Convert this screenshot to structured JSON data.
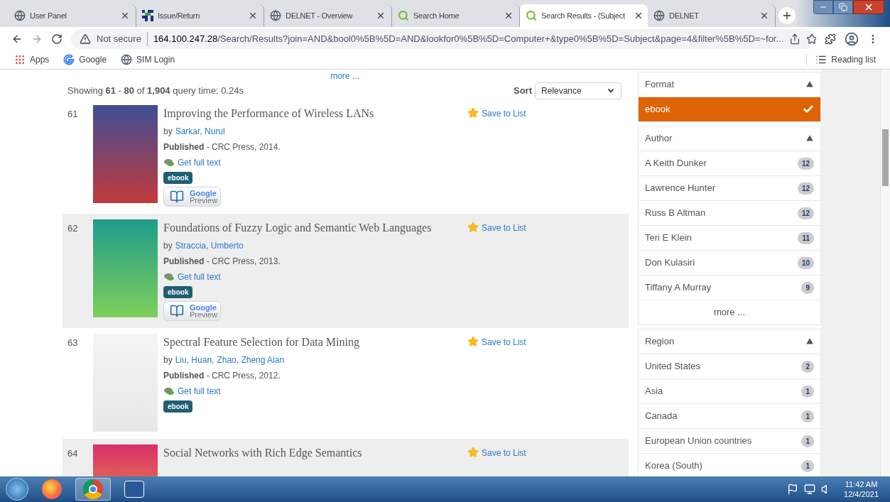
{
  "tabs": [
    {
      "title": "User Panel",
      "kind": "globe",
      "selected": false
    },
    {
      "title": "Issue/Return",
      "kind": "grid",
      "selected": false
    },
    {
      "title": "DELNET - Overview",
      "kind": "globe",
      "selected": false
    },
    {
      "title": "Search Home",
      "kind": "search",
      "selected": false
    },
    {
      "title": "Search Results - (Subject",
      "kind": "search",
      "selected": true
    },
    {
      "title": "DELNET",
      "kind": "globe",
      "selected": false
    }
  ],
  "address_bar": {
    "security": "Not secure",
    "host": "164.100.247.28",
    "path": "/Search/Results?join=AND&bool0%5B%5D=AND&lookfor0%5B%5D=Computer+&type0%5B%5D=Subject&page=4&filter%5B%5D=~for..."
  },
  "bookmarks": [
    {
      "label": "Apps",
      "kind": "apps"
    },
    {
      "label": "Google",
      "kind": "google"
    },
    {
      "label": "SIM Login",
      "kind": "globe"
    }
  ],
  "reading_list": "Reading list",
  "top_more": "more ...",
  "summary": "Showing **61** - **80** of **1,904** query time: 0.24s",
  "sort": {
    "label": "Sort",
    "value": "Relevance"
  },
  "results": [
    {
      "number": "61",
      "title": "Improving the Performance of Wireless LANs",
      "by_label": "by",
      "authors": [
        "Sarkar, Nurul"
      ],
      "published_label": "Published",
      "published": " - CRC Press, 2014.",
      "full_text": "Get full text",
      "format": "ebook",
      "preview": [
        "Google",
        "Preview"
      ],
      "save": "Save to List"
    },
    {
      "number": "62",
      "title": "Foundations of Fuzzy Logic and Semantic Web Languages",
      "by_label": "by",
      "authors": [
        "Straccia, Umberto"
      ],
      "published_label": "Published",
      "published": " - CRC Press, 2013.",
      "full_text": "Get full text",
      "format": "ebook",
      "preview": [
        "Google",
        "Preview"
      ],
      "save": "Save to List"
    },
    {
      "number": "63",
      "title": "Spectral Feature Selection for Data Mining",
      "by_label": "by",
      "authors": [
        "Liu, Huan,",
        "Zhao, Zheng Alan"
      ],
      "published_label": "Published",
      "published": " - CRC Press, 2012.",
      "full_text": "Get full text",
      "format": "ebook",
      "save": "Save to List"
    },
    {
      "number": "64",
      "title": "Social Networks with Rich Edge Semantics",
      "save": "Save to List"
    }
  ],
  "facets": [
    {
      "title": "Format",
      "expanded": true,
      "items": [
        {
          "label": "ebook",
          "selected": true
        }
      ]
    },
    {
      "title": "Author",
      "expanded": true,
      "items": [
        {
          "label": "A Keith Dunker",
          "count": "12",
          "selected": false
        },
        {
          "label": "Lawrence Hunter",
          "count": "12",
          "selected": false
        },
        {
          "label": "Russ B Altman",
          "count": "12",
          "selected": false
        },
        {
          "label": "Teri E Klein",
          "count": "11",
          "selected": false
        },
        {
          "label": "Don Kulasiri",
          "count": "10",
          "selected": false
        },
        {
          "label": "Tiffany A Murray",
          "count": "9",
          "selected": false
        }
      ],
      "more": "more ..."
    },
    {
      "title": "Region",
      "expanded": true,
      "items": [
        {
          "label": "United States",
          "count": "2",
          "selected": false
        },
        {
          "label": "Asia",
          "count": "1",
          "selected": false
        },
        {
          "label": "Canada",
          "count": "1",
          "selected": false
        },
        {
          "label": "European Union countries",
          "count": "1",
          "selected": false
        },
        {
          "label": "Korea (South)",
          "count": "1",
          "selected": false
        }
      ]
    }
  ],
  "taskbar": {
    "apps": [
      {
        "kind": "firefox",
        "selected": false
      },
      {
        "kind": "chrome",
        "selected": true
      },
      {
        "kind": "word",
        "selected": false
      }
    ],
    "time": "11:42 AM",
    "date": "12/4/2021"
  }
}
